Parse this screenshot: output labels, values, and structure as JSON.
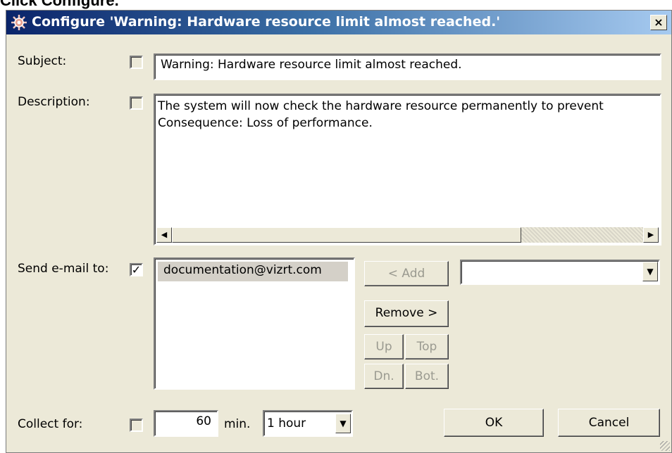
{
  "doc_heading": "Click Configure.",
  "window": {
    "title": "Configure 'Warning: Hardware resource limit almost reached.'",
    "title_icon": "gear-icon",
    "close_label": "×"
  },
  "subject": {
    "label": "Subject:",
    "override_checked": false,
    "value": "Warning: Hardware resource limit almost reached."
  },
  "description": {
    "label": "Description:",
    "override_checked": false,
    "lines": [
      "The system will now check the hardware resource permanently to prevent",
      "Consequence: Loss of performance."
    ]
  },
  "email": {
    "label": "Send e-mail to:",
    "enabled_checked": true,
    "recipients": [
      "documentation@vizrt.com"
    ],
    "add_label": "<    Add",
    "remove_label": "Remove >",
    "up_label": "Up",
    "top_label": "Top",
    "down_label": "Dn.",
    "bottom_label": "Bot.",
    "address_combo_value": ""
  },
  "collect": {
    "label": "Collect for:",
    "override_checked": false,
    "value": "60",
    "unit_label": "min.",
    "interval_value": "1 hour"
  },
  "buttons": {
    "ok": "OK",
    "cancel": "Cancel"
  }
}
